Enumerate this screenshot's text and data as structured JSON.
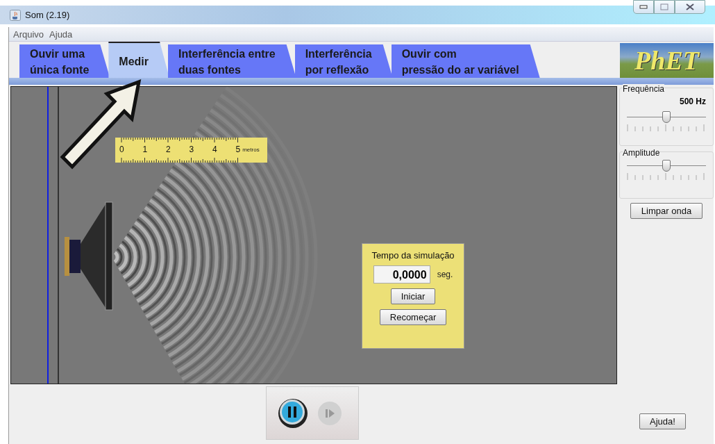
{
  "window": {
    "title": "Som (2.19)"
  },
  "menu": [
    "Arquivo",
    "Ajuda"
  ],
  "tabs": [
    {
      "lines": [
        "Ouvir uma",
        "única fonte"
      ],
      "selected": false
    },
    {
      "lines": [
        "Medir"
      ],
      "selected": true
    },
    {
      "lines": [
        "Interferência entre",
        "duas fontes"
      ],
      "selected": false
    },
    {
      "lines": [
        "Interferência",
        "por reflexão"
      ],
      "selected": false
    },
    {
      "lines": [
        "Ouvir com",
        "pressão do ar variável"
      ],
      "selected": false
    }
  ],
  "logo": "PhET",
  "ruler": {
    "labels": [
      "0",
      "1",
      "2",
      "3",
      "4",
      "5"
    ],
    "unit": "metros"
  },
  "timer": {
    "title": "Tempo da simulação",
    "value": "0,0000",
    "unit": "seg.",
    "buttons": [
      "Iniciar",
      "Recomeçar"
    ]
  },
  "controls": [
    {
      "title": "Frequência",
      "reading": "500 Hz",
      "level": 0.5
    },
    {
      "title": "Amplitude",
      "level": 0.5
    }
  ],
  "clear_button": "Limpar onda",
  "playback": {
    "playing": true,
    "step_disabled": true
  },
  "help_button": "Ajuda!"
}
